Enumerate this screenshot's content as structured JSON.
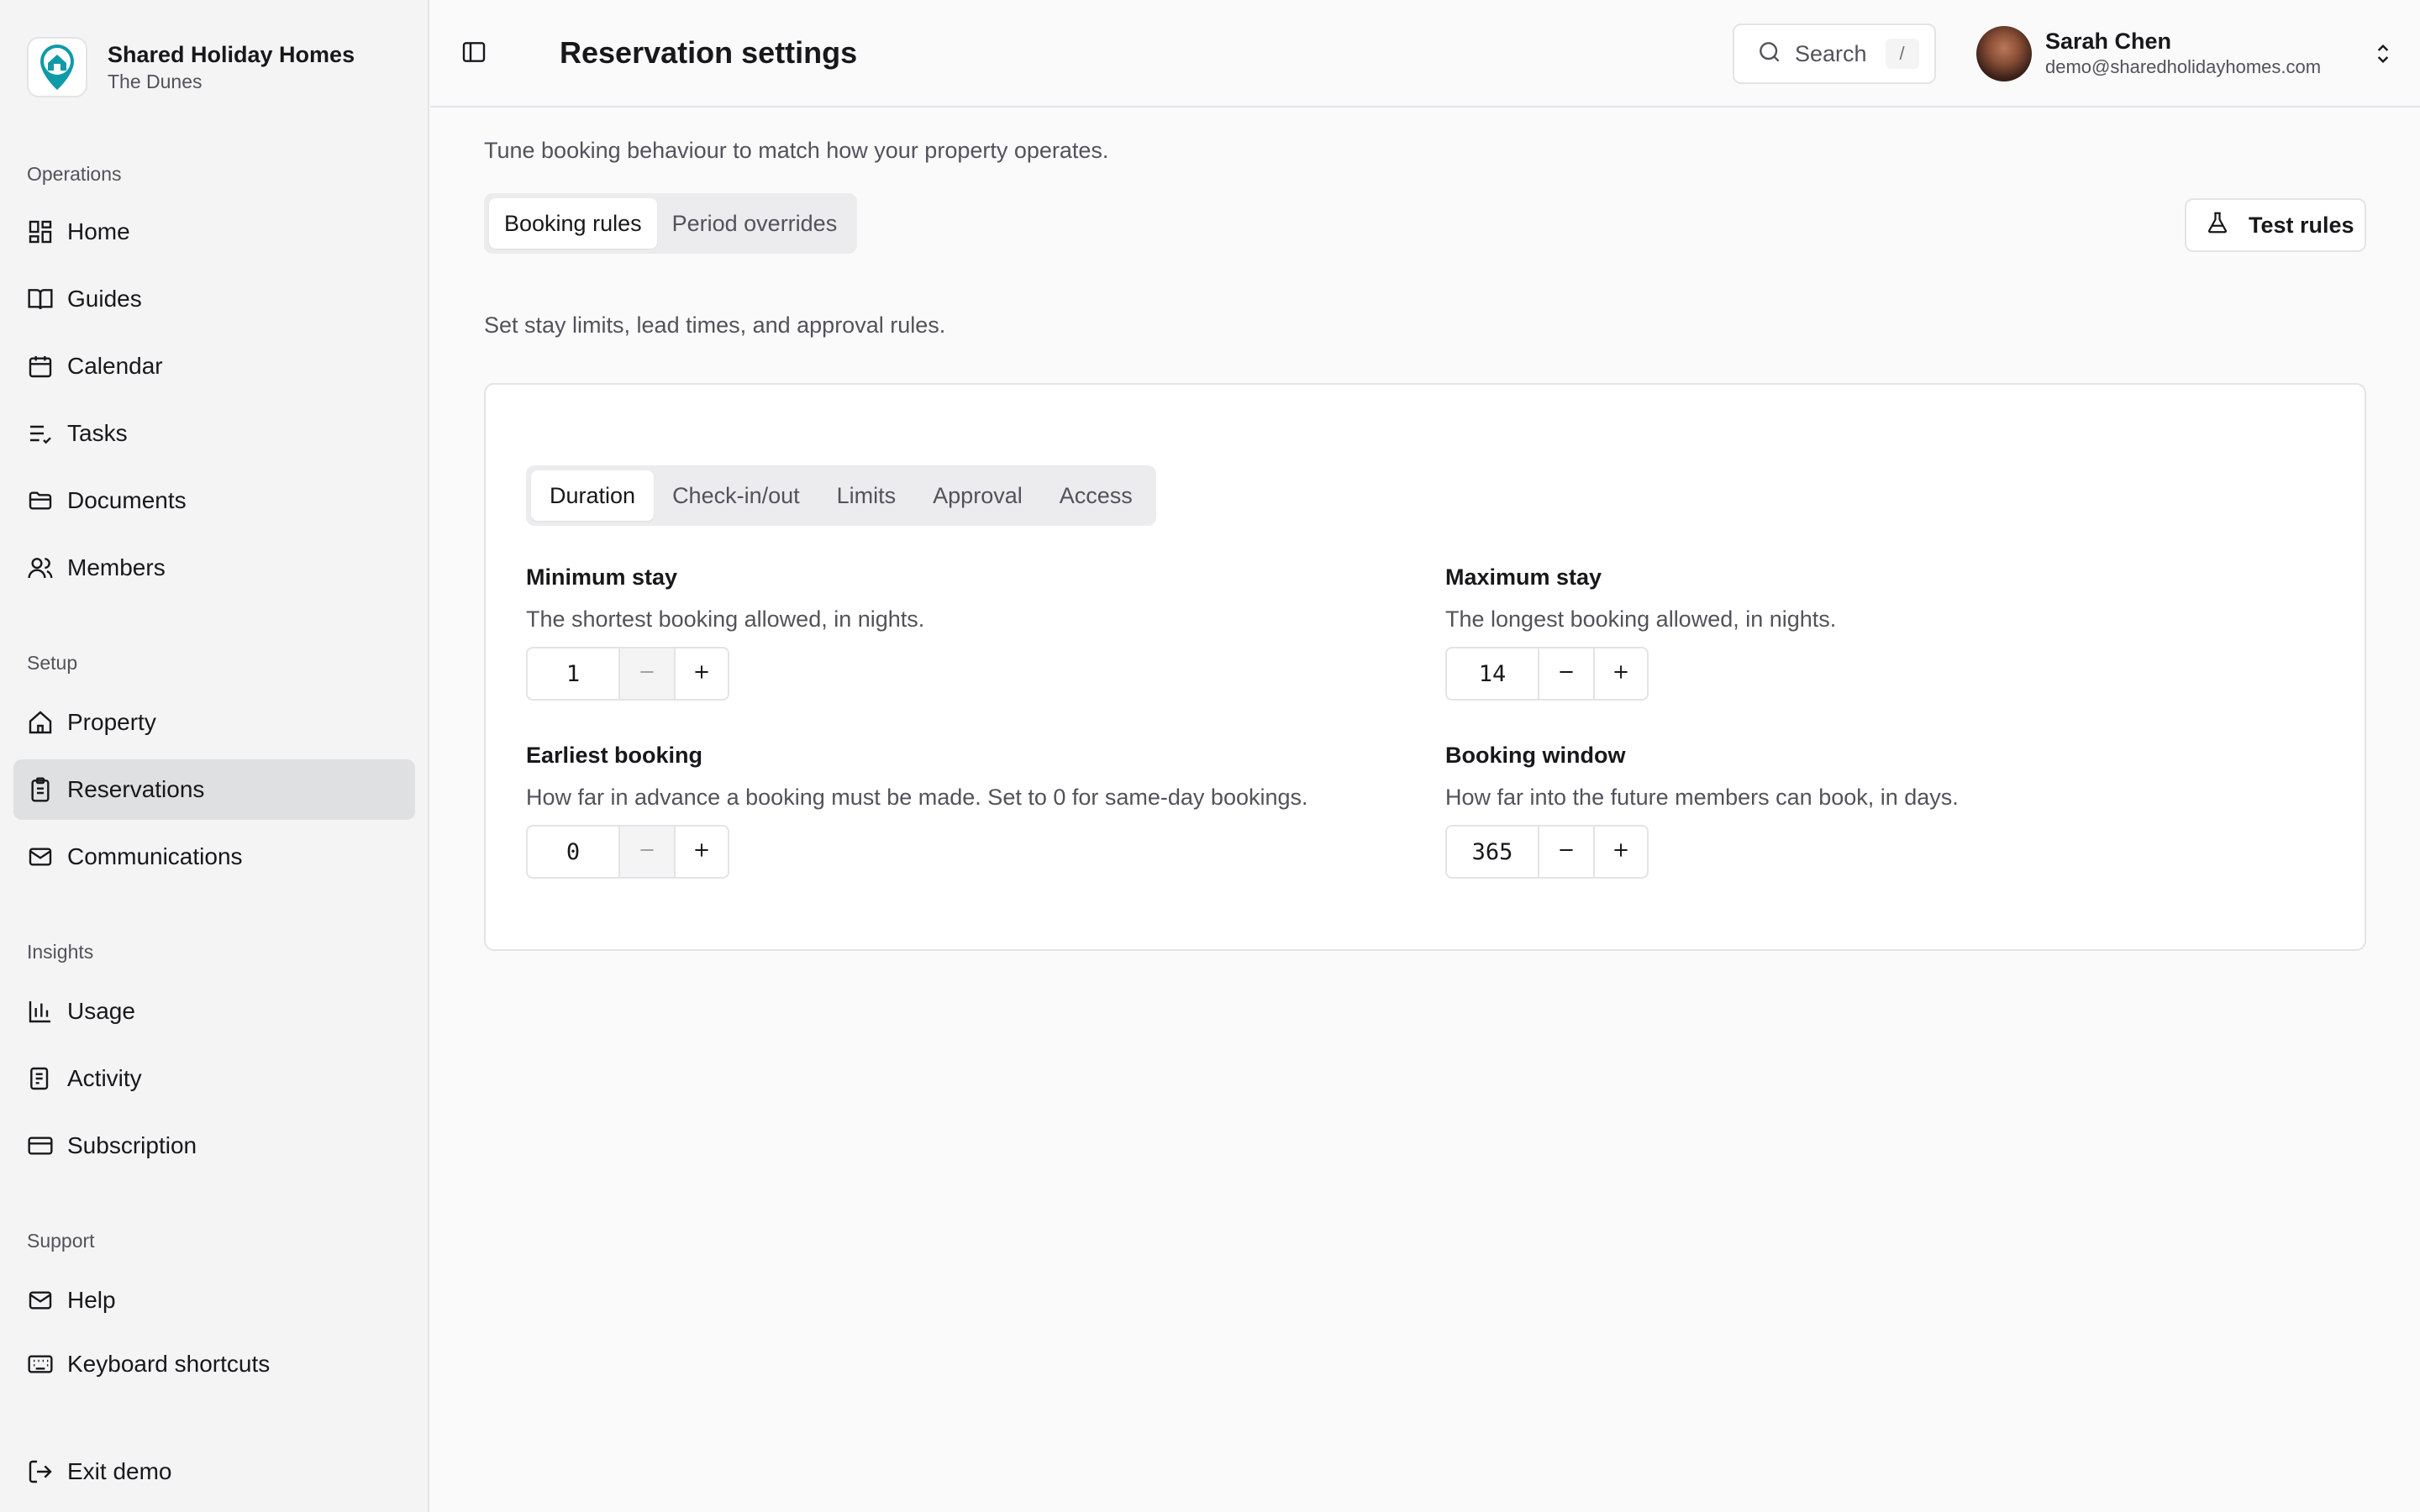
{
  "brand": {
    "name": "Shared Holiday Homes",
    "property": "The Dunes"
  },
  "sidebar": {
    "sections": [
      {
        "label": "Operations"
      },
      {
        "label": "Setup"
      },
      {
        "label": "Insights"
      },
      {
        "label": "Support"
      }
    ],
    "items": [
      {
        "label": "Home",
        "icon": "dashboard-icon"
      },
      {
        "label": "Guides",
        "icon": "book-icon"
      },
      {
        "label": "Calendar",
        "icon": "calendar-icon"
      },
      {
        "label": "Tasks",
        "icon": "tasks-icon"
      },
      {
        "label": "Documents",
        "icon": "folder-icon"
      },
      {
        "label": "Members",
        "icon": "users-icon"
      },
      {
        "label": "Property",
        "icon": "home-icon"
      },
      {
        "label": "Reservations",
        "icon": "clipboard-icon",
        "active": true
      },
      {
        "label": "Communications",
        "icon": "mail-icon"
      },
      {
        "label": "Usage",
        "icon": "bar-chart-icon"
      },
      {
        "label": "Activity",
        "icon": "history-icon"
      },
      {
        "label": "Subscription",
        "icon": "credit-card-icon"
      },
      {
        "label": "Help",
        "icon": "mail-icon"
      },
      {
        "label": "Keyboard shortcuts",
        "icon": "keyboard-icon"
      },
      {
        "label": "Exit demo",
        "icon": "logout-icon"
      }
    ]
  },
  "header": {
    "title": "Reservation settings",
    "search": {
      "label": "Search",
      "shortcut": "/"
    },
    "user": {
      "name": "Sarah Chen",
      "email": "demo@sharedholidayhomes.com"
    }
  },
  "page": {
    "intro": "Tune booking behaviour to match how your property operates.",
    "tabs": [
      {
        "label": "Booking rules",
        "active": true
      },
      {
        "label": "Period overrides"
      }
    ],
    "test_button": "Test rules",
    "section_intro": "Set stay limits, lead times, and approval rules.",
    "inner_tabs": [
      {
        "label": "Duration",
        "active": true
      },
      {
        "label": "Check-in/out"
      },
      {
        "label": "Limits"
      },
      {
        "label": "Approval"
      },
      {
        "label": "Access"
      }
    ],
    "fields": [
      {
        "label": "Minimum stay",
        "help": "The shortest booking allowed, in nights.",
        "value": "1",
        "decrement_disabled": true
      },
      {
        "label": "Maximum stay",
        "help": "The longest booking allowed, in nights.",
        "value": "14",
        "decrement_disabled": false
      },
      {
        "label": "Earliest booking",
        "help": "How far in advance a booking must be made. Set to 0 for same-day bookings.",
        "value": "0",
        "decrement_disabled": true
      },
      {
        "label": "Booking window",
        "help": "How far into the future members can book, in days.",
        "value": "365",
        "decrement_disabled": false
      }
    ]
  },
  "colors": {
    "active_nav": "#dfe0e2",
    "brand_teal": "#0f9aa8",
    "text_muted": "#52525b"
  }
}
